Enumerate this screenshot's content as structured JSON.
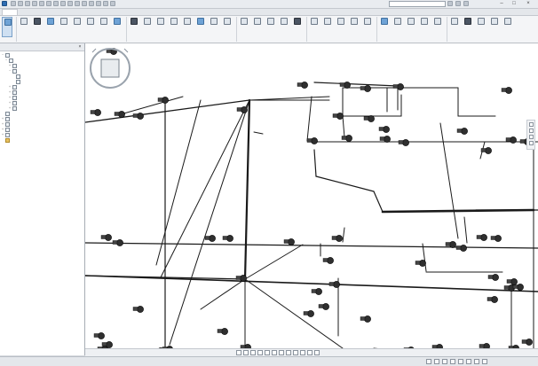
{
  "window": {
    "title": "",
    "search_placeholder": ""
  },
  "tabs": [
    {
      "label": "",
      "active": true
    },
    {
      "label": "",
      "active": false
    },
    {
      "label": "",
      "active": false
    },
    {
      "label": "",
      "active": false
    },
    {
      "label": "",
      "active": false
    },
    {
      "label": "",
      "active": false
    },
    {
      "label": "",
      "active": false
    },
    {
      "label": "",
      "active": false
    },
    {
      "label": "",
      "active": false
    },
    {
      "label": "",
      "active": false
    },
    {
      "label": "",
      "active": false
    },
    {
      "label": "",
      "active": false
    },
    {
      "label": "",
      "active": false
    },
    {
      "label": "",
      "active": false
    },
    {
      "label": "",
      "active": false
    },
    {
      "label": "",
      "active": false
    },
    {
      "label": "",
      "active": false
    },
    {
      "label": "",
      "active": false
    },
    {
      "label": "",
      "active": false
    }
  ],
  "ribbon": {
    "buttons": [
      {
        "label": "",
        "icon": "modify-icon"
      },
      {
        "label": "",
        "icon": "duct-icon"
      },
      {
        "label": "",
        "icon": "duct-fitting-icon"
      },
      {
        "label": "",
        "icon": "pipe-icon"
      },
      {
        "label": "",
        "icon": "pipe-fitting-icon"
      },
      {
        "label": "",
        "icon": "cable-tray-icon"
      },
      {
        "label": "",
        "icon": "conduit-icon"
      },
      {
        "label": "",
        "icon": "air-terminal-icon"
      },
      {
        "label": "",
        "icon": "mechanical-equipment-icon"
      },
      {
        "label": "",
        "icon": "pipe-accessory-icon"
      },
      {
        "label": "",
        "icon": "sprinkler-icon"
      },
      {
        "label": "",
        "icon": "plumbing-fixture-icon"
      },
      {
        "label": "",
        "icon": "fitting-icon"
      },
      {
        "label": "",
        "icon": "component-icon"
      },
      {
        "label": "",
        "icon": "electrical-equipment-icon"
      },
      {
        "label": "",
        "icon": "lighting-fixture-icon"
      },
      {
        "label": "",
        "icon": "device-icon"
      },
      {
        "label": "",
        "icon": "wire-icon"
      },
      {
        "label": "",
        "icon": "panel-schedule-icon"
      },
      {
        "label": "",
        "icon": "space-icon"
      },
      {
        "label": "",
        "icon": "zone-icon"
      },
      {
        "label": "",
        "icon": "tag-icon"
      },
      {
        "label": "",
        "icon": "set-workplane-icon"
      },
      {
        "label": "",
        "icon": "show-icon"
      },
      {
        "label": "",
        "icon": "viewer-icon"
      },
      {
        "label": "",
        "icon": "ref-plane-icon"
      },
      {
        "label": "",
        "icon": "text-icon"
      },
      {
        "label": "",
        "icon": "tag-all-icon"
      },
      {
        "label": "",
        "icon": "room-icon"
      },
      {
        "label": "",
        "icon": "settings-icon"
      },
      {
        "label": "",
        "icon": "load-icon"
      },
      {
        "label": "",
        "icon": "schedule-icon"
      },
      {
        "label": "",
        "icon": "detail-icon"
      },
      {
        "label": "",
        "icon": "component-list-icon"
      },
      {
        "label": "",
        "icon": "dimension-icon"
      },
      {
        "label": "",
        "icon": "annotate-icon"
      },
      {
        "label": "",
        "icon": "symbol-icon"
      }
    ],
    "panels": [
      {
        "title": ""
      },
      {
        "title": ""
      },
      {
        "title": ""
      },
      {
        "title": ""
      },
      {
        "title": ""
      },
      {
        "title": ""
      },
      {
        "title": ""
      }
    ]
  },
  "browser": {
    "title": "",
    "items": [
      {
        "label": "",
        "indent": 0,
        "toggle": "−",
        "icon": "views-icon"
      },
      {
        "label": "",
        "indent": 1,
        "toggle": "−",
        "icon": "folder-icon"
      },
      {
        "label": "",
        "indent": 2,
        "toggle": "+",
        "icon": "view-icon"
      },
      {
        "label": "",
        "indent": 2,
        "toggle": "−",
        "icon": "view-icon"
      },
      {
        "label": "",
        "indent": 3,
        "toggle": "",
        "icon": "floor-plan-icon"
      },
      {
        "label": "",
        "indent": 3,
        "toggle": "",
        "icon": "floor-plan-icon"
      },
      {
        "label": "",
        "indent": 2,
        "toggle": "+",
        "icon": "view-icon"
      },
      {
        "label": "",
        "indent": 2,
        "toggle": "+",
        "icon": "view-icon"
      },
      {
        "label": "",
        "indent": 2,
        "toggle": "+",
        "icon": "view-icon"
      },
      {
        "label": "",
        "indent": 2,
        "toggle": "+",
        "icon": "view-icon"
      },
      {
        "label": "",
        "indent": 2,
        "toggle": "+",
        "icon": "view-icon"
      },
      {
        "label": "",
        "indent": 0,
        "toggle": "",
        "icon": "legend-icon"
      },
      {
        "label": "",
        "indent": 0,
        "toggle": "+",
        "icon": "schedules-icon"
      },
      {
        "label": "",
        "indent": 0,
        "toggle": "+",
        "icon": "sheets-icon"
      },
      {
        "label": "",
        "indent": 0,
        "toggle": "+",
        "icon": "families-icon"
      },
      {
        "label": "",
        "indent": 0,
        "toggle": "+",
        "icon": "groups-icon"
      },
      {
        "label": "",
        "indent": 0,
        "toggle": "",
        "icon": "revit-links-icon"
      }
    ]
  },
  "viewcube": {
    "face_label": "",
    "compass": [
      "",
      "",
      "",
      ""
    ]
  },
  "status": {
    "text": "",
    "right": ""
  },
  "colors": {
    "pipe": "#1a1a1a",
    "fixture": "#333333",
    "canvas": "#ffffff",
    "accent": "#3f6f9f"
  }
}
